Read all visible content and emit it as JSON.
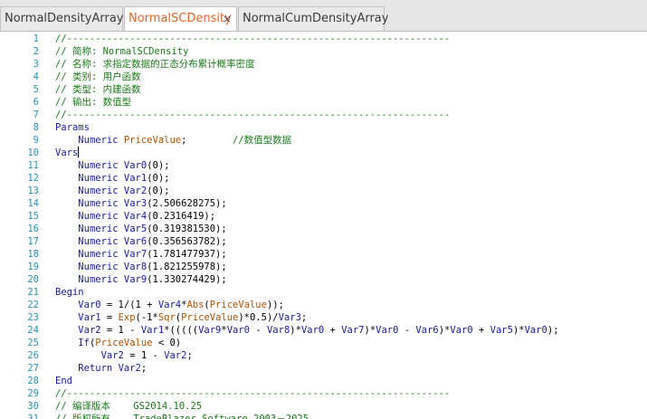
{
  "tabs": [
    {
      "label": "NormalDensityArray",
      "active": false
    },
    {
      "label": "NormalSCDensity",
      "active": true,
      "close": "×"
    },
    {
      "label": "NormalCumDensityArray",
      "active": false
    }
  ],
  "editor": {
    "lines": [
      {
        "n": "1",
        "g": "",
        "tokens": [
          {
            "t": "//-------------------------------------------------------------------",
            "c": "comment"
          }
        ]
      },
      {
        "n": "2",
        "g": "",
        "tokens": [
          {
            "t": "// 简称: NormalSCDensity",
            "c": "comment"
          }
        ]
      },
      {
        "n": "3",
        "g": "",
        "tokens": [
          {
            "t": "// 名称: 求指定数据的正态分布累计概率密度",
            "c": "comment"
          }
        ]
      },
      {
        "n": "4",
        "g": "",
        "tokens": [
          {
            "t": "// 类别: 用户函数",
            "c": "comment"
          }
        ]
      },
      {
        "n": "5",
        "g": "",
        "tokens": [
          {
            "t": "// 类型: 内建函数",
            "c": "comment"
          }
        ]
      },
      {
        "n": "6",
        "g": "",
        "tokens": [
          {
            "t": "// 输出: 数值型",
            "c": "comment"
          }
        ]
      },
      {
        "n": "7",
        "g": "",
        "tokens": [
          {
            "t": "//-------------------------------------------------------------------",
            "c": "comment"
          }
        ]
      },
      {
        "n": "8",
        "g": "",
        "tokens": [
          {
            "t": "Params",
            "c": "keyword"
          }
        ]
      },
      {
        "n": "9",
        "g": "",
        "tokens": [
          {
            "t": "    ",
            "c": "plain"
          },
          {
            "t": "Numeric",
            "c": "type"
          },
          {
            "t": " ",
            "c": "plain"
          },
          {
            "t": "PriceValue",
            "c": "param"
          },
          {
            "t": ";        ",
            "c": "plain"
          },
          {
            "t": "//数值型数据",
            "c": "comment"
          }
        ]
      },
      {
        "n": "10",
        "g": "",
        "caret": true,
        "tokens": [
          {
            "t": "Vars",
            "c": "keyword"
          }
        ]
      },
      {
        "n": "11",
        "g": "",
        "tokens": [
          {
            "t": "    ",
            "c": "plain"
          },
          {
            "t": "Numeric",
            "c": "type"
          },
          {
            "t": " ",
            "c": "plain"
          },
          {
            "t": "Var0",
            "c": "ident"
          },
          {
            "t": "(0);",
            "c": "plain"
          }
        ]
      },
      {
        "n": "12",
        "g": "",
        "tokens": [
          {
            "t": "    ",
            "c": "plain"
          },
          {
            "t": "Numeric",
            "c": "type"
          },
          {
            "t": " ",
            "c": "plain"
          },
          {
            "t": "Var1",
            "c": "ident"
          },
          {
            "t": "(0);",
            "c": "plain"
          }
        ]
      },
      {
        "n": "13",
        "g": "",
        "tokens": [
          {
            "t": "    ",
            "c": "plain"
          },
          {
            "t": "Numeric",
            "c": "type"
          },
          {
            "t": " ",
            "c": "plain"
          },
          {
            "t": "Var2",
            "c": "ident"
          },
          {
            "t": "(0);",
            "c": "plain"
          }
        ]
      },
      {
        "n": "14",
        "g": "",
        "tokens": [
          {
            "t": "    ",
            "c": "plain"
          },
          {
            "t": "Numeric",
            "c": "type"
          },
          {
            "t": " ",
            "c": "plain"
          },
          {
            "t": "Var3",
            "c": "ident"
          },
          {
            "t": "(2.506628275);",
            "c": "plain"
          }
        ]
      },
      {
        "n": "15",
        "g": "",
        "tokens": [
          {
            "t": "    ",
            "c": "plain"
          },
          {
            "t": "Numeric",
            "c": "type"
          },
          {
            "t": " ",
            "c": "plain"
          },
          {
            "t": "Var4",
            "c": "ident"
          },
          {
            "t": "(0.2316419);",
            "c": "plain"
          }
        ]
      },
      {
        "n": "16",
        "g": "",
        "tokens": [
          {
            "t": "    ",
            "c": "plain"
          },
          {
            "t": "Numeric",
            "c": "type"
          },
          {
            "t": " ",
            "c": "plain"
          },
          {
            "t": "Var5",
            "c": "ident"
          },
          {
            "t": "(0.319381530);",
            "c": "plain"
          }
        ]
      },
      {
        "n": "17",
        "g": "",
        "tokens": [
          {
            "t": "    ",
            "c": "plain"
          },
          {
            "t": "Numeric",
            "c": "type"
          },
          {
            "t": " ",
            "c": "plain"
          },
          {
            "t": "Var6",
            "c": "ident"
          },
          {
            "t": "(0.356563782);",
            "c": "plain"
          }
        ]
      },
      {
        "n": "18",
        "g": "",
        "tokens": [
          {
            "t": "    ",
            "c": "plain"
          },
          {
            "t": "Numeric",
            "c": "type"
          },
          {
            "t": " ",
            "c": "plain"
          },
          {
            "t": "Var7",
            "c": "ident"
          },
          {
            "t": "(1.781477937);",
            "c": "plain"
          }
        ]
      },
      {
        "n": "19",
        "g": "",
        "tokens": [
          {
            "t": "    ",
            "c": "plain"
          },
          {
            "t": "Numeric",
            "c": "type"
          },
          {
            "t": " ",
            "c": "plain"
          },
          {
            "t": "Var8",
            "c": "ident"
          },
          {
            "t": "(1.821255978);",
            "c": "plain"
          }
        ]
      },
      {
        "n": "20",
        "g": "",
        "tokens": [
          {
            "t": "    ",
            "c": "plain"
          },
          {
            "t": "Numeric",
            "c": "type"
          },
          {
            "t": " ",
            "c": "plain"
          },
          {
            "t": "Var9",
            "c": "ident"
          },
          {
            "t": "(1.330274429);",
            "c": "plain"
          }
        ]
      },
      {
        "n": "21",
        "g": "",
        "tokens": [
          {
            "t": "Begin",
            "c": "keyword"
          }
        ]
      },
      {
        "n": "22",
        "g": "",
        "tokens": [
          {
            "t": "    ",
            "c": "plain"
          },
          {
            "t": "Var0",
            "c": "ident"
          },
          {
            "t": " = 1/(1 + ",
            "c": "plain"
          },
          {
            "t": "Var4",
            "c": "ident"
          },
          {
            "t": "*",
            "c": "plain"
          },
          {
            "t": "Abs",
            "c": "func"
          },
          {
            "t": "(",
            "c": "plain"
          },
          {
            "t": "PriceValue",
            "c": "param"
          },
          {
            "t": "));",
            "c": "plain"
          }
        ]
      },
      {
        "n": "23",
        "g": "",
        "tokens": [
          {
            "t": "    ",
            "c": "plain"
          },
          {
            "t": "Var1",
            "c": "ident"
          },
          {
            "t": " = ",
            "c": "plain"
          },
          {
            "t": "Exp",
            "c": "func"
          },
          {
            "t": "(-1*",
            "c": "plain"
          },
          {
            "t": "Sqr",
            "c": "func"
          },
          {
            "t": "(",
            "c": "plain"
          },
          {
            "t": "PriceValue",
            "c": "param"
          },
          {
            "t": ")*0.5)/",
            "c": "plain"
          },
          {
            "t": "Var3",
            "c": "ident"
          },
          {
            "t": ";",
            "c": "plain"
          }
        ]
      },
      {
        "n": "24",
        "g": "",
        "tokens": [
          {
            "t": "    ",
            "c": "plain"
          },
          {
            "t": "Var2",
            "c": "ident"
          },
          {
            "t": " = 1 - ",
            "c": "plain"
          },
          {
            "t": "Var1",
            "c": "ident"
          },
          {
            "t": "*(((((",
            "c": "plain"
          },
          {
            "t": "Var9",
            "c": "ident"
          },
          {
            "t": "*",
            "c": "plain"
          },
          {
            "t": "Var0",
            "c": "ident"
          },
          {
            "t": " - ",
            "c": "plain"
          },
          {
            "t": "Var8",
            "c": "ident"
          },
          {
            "t": ")*",
            "c": "plain"
          },
          {
            "t": "Var0",
            "c": "ident"
          },
          {
            "t": " + ",
            "c": "plain"
          },
          {
            "t": "Var7",
            "c": "ident"
          },
          {
            "t": ")*",
            "c": "plain"
          },
          {
            "t": "Var0",
            "c": "ident"
          },
          {
            "t": " - ",
            "c": "plain"
          },
          {
            "t": "Var6",
            "c": "ident"
          },
          {
            "t": ")*",
            "c": "plain"
          },
          {
            "t": "Var0",
            "c": "ident"
          },
          {
            "t": " + ",
            "c": "plain"
          },
          {
            "t": "Var5",
            "c": "ident"
          },
          {
            "t": ")*",
            "c": "plain"
          },
          {
            "t": "Var0",
            "c": "ident"
          },
          {
            "t": ");",
            "c": "plain"
          }
        ]
      },
      {
        "n": "25",
        "g": "",
        "tokens": [
          {
            "t": "    ",
            "c": "plain"
          },
          {
            "t": "If",
            "c": "keyword"
          },
          {
            "t": "(",
            "c": "plain"
          },
          {
            "t": "PriceValue",
            "c": "param"
          },
          {
            "t": " < 0)",
            "c": "plain"
          }
        ]
      },
      {
        "n": "26",
        "g": "",
        "tokens": [
          {
            "t": "        ",
            "c": "plain"
          },
          {
            "t": "Var2",
            "c": "ident"
          },
          {
            "t": " = 1 - ",
            "c": "plain"
          },
          {
            "t": "Var2",
            "c": "ident"
          },
          {
            "t": ";",
            "c": "plain"
          }
        ]
      },
      {
        "n": "27",
        "g": "",
        "tokens": [
          {
            "t": "    ",
            "c": "plain"
          },
          {
            "t": "Return",
            "c": "keyword"
          },
          {
            "t": " ",
            "c": "plain"
          },
          {
            "t": "Var2",
            "c": "ident"
          },
          {
            "t": ";",
            "c": "plain"
          }
        ]
      },
      {
        "n": "28",
        "g": "",
        "tokens": [
          {
            "t": "End",
            "c": "keyword"
          }
        ]
      },
      {
        "n": "29",
        "g": "",
        "tokens": [
          {
            "t": "//-------------------------------------------------------------------",
            "c": "comment"
          }
        ]
      },
      {
        "n": "30",
        "g": "",
        "tokens": [
          {
            "t": "// 编译版本    GS2014.10.25",
            "c": "comment"
          }
        ]
      },
      {
        "n": "31",
        "g": "",
        "tokens": [
          {
            "t": "// 版权所有    TradeBlazer Software 2003－2025",
            "c": "comment"
          }
        ]
      }
    ]
  },
  "colors": {
    "active_tab_text": "#e8642a",
    "line_number": "#2b91af",
    "comment": "#1b7a1b",
    "keyword": "#1a1aa6",
    "param": "#b45000"
  }
}
